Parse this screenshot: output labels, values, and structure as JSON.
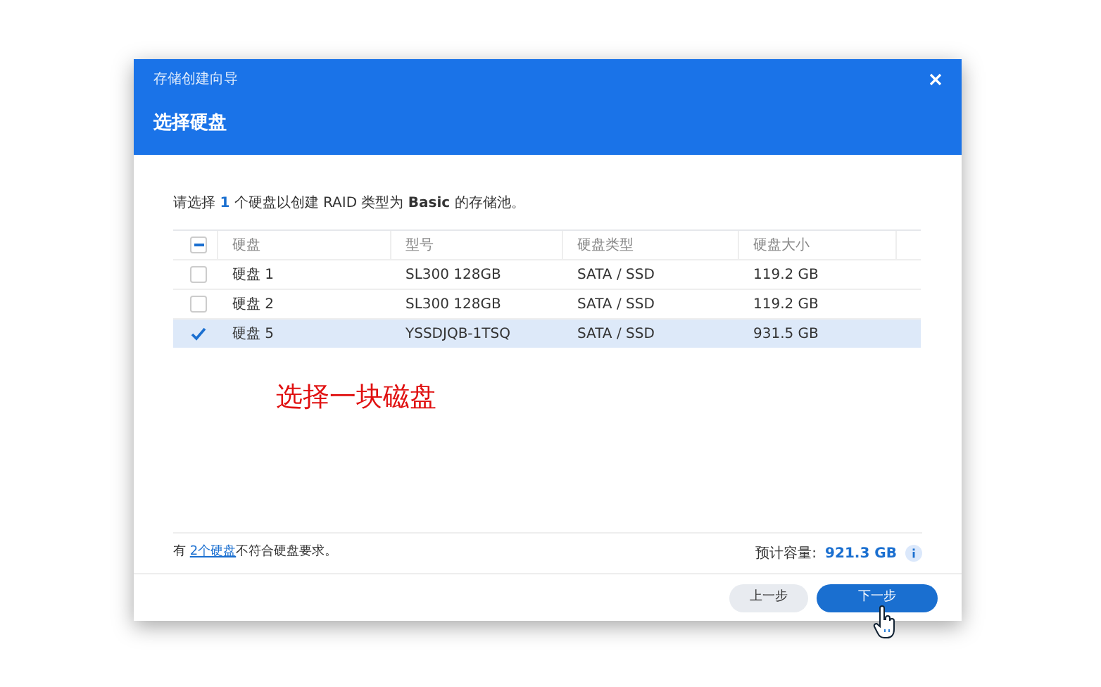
{
  "window": {
    "title": "存储创建向导",
    "heading": "选择硬盘"
  },
  "intro": {
    "before": "请选择 ",
    "count": "1",
    "after": " 个硬盘以创建 RAID 类型为 **Basic** 的存储池。"
  },
  "table": {
    "select_all_partial": true,
    "columns": [
      "硬盘",
      "型号",
      "硬盘类型",
      "硬盘大小"
    ],
    "rows": [
      {
        "selected": false,
        "cells": [
          "硬盘 1",
          "SL300 128GB",
          "SATA / SSD",
          "119.2 GB"
        ]
      },
      {
        "selected": false,
        "cells": [
          "硬盘 2",
          "SL300 128GB",
          "SATA / SSD",
          "119.2 GB"
        ]
      },
      {
        "selected": true,
        "cells": [
          "硬盘 5",
          "YSSDJQB-1TSQ",
          "SATA / SSD",
          "931.5 GB"
        ]
      }
    ]
  },
  "annotation": "选择一块磁盘",
  "footer": {
    "before": "有 ",
    "link": "2个硬盘",
    "after": "不符合硬盘要求。",
    "capacity_label": "预计容量:",
    "capacity": "921.3 GB"
  },
  "buttons": [
    {
      "label": "上一步",
      "kind": "secondary"
    },
    {
      "label": "下一步",
      "kind": "primary"
    }
  ]
}
